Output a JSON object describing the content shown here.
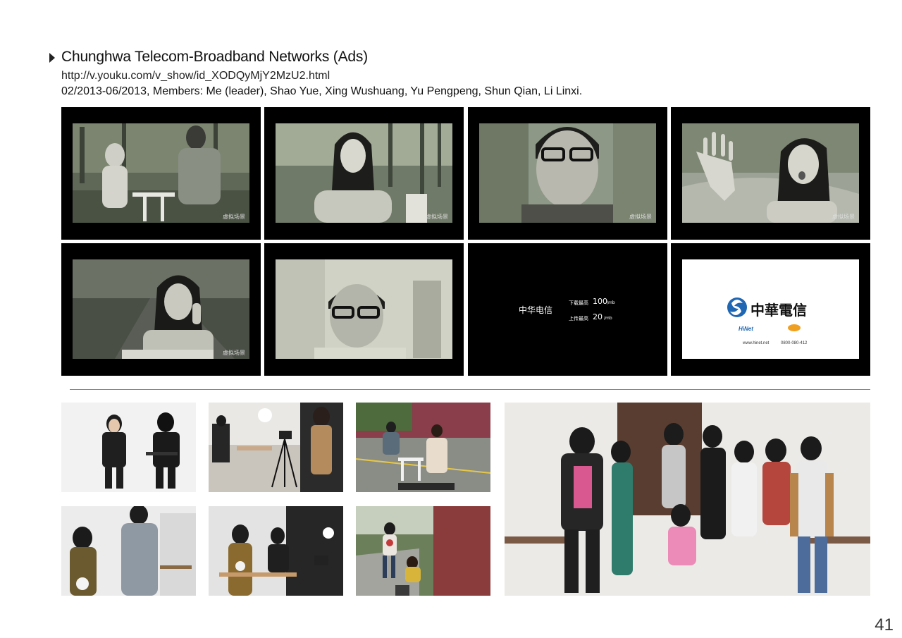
{
  "header": {
    "title": "Chunghwa Telecom-Broadband Networks (Ads)",
    "link": "http://v.youku.com/v_show/id_XODQyMjY2MzU2.html",
    "meta": "02/2013-06/2013, Members: Me (leader), Shao Yue, Xing Wushuang, Yu Pengpeng, Shun Qian, Li Linxi."
  },
  "storyboard": {
    "watermark": "虚拟场景",
    "tagline_card": {
      "brand": "中华电信",
      "download_label": "下载最高",
      "download_value": "100",
      "download_unit": "/mb",
      "upload_label": "上传最高",
      "upload_value": "20",
      "upload_unit": "/mb"
    },
    "logo_card": {
      "brand": "中華電信",
      "hinet": "HiNet",
      "url": "www.hinet.net",
      "phone": "0800-080-412"
    }
  },
  "page_number": "41"
}
